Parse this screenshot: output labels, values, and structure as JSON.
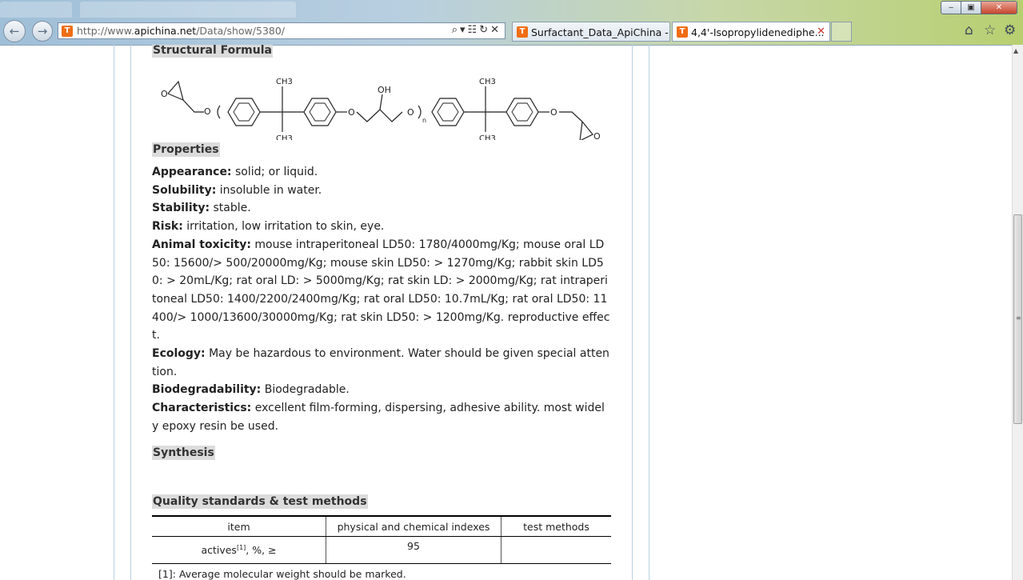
{
  "browser": {
    "url_prefix": "http://www.",
    "url_domain": "apichina.net",
    "url_path": "/Data/show/5380/",
    "tabs": [
      {
        "label": "Surfactant_Data_ApiChina - ..."
      },
      {
        "label": "4,4'-Isopropylidenediphe..."
      }
    ]
  },
  "page": {
    "structural_formula_heading": "Structural Formula",
    "properties_heading": "Properties",
    "properties": [
      {
        "label": "Appearance:",
        "value": " solid; or liquid."
      },
      {
        "label": "Solubility:",
        "value": " insoluble in water."
      },
      {
        "label": "Stability:",
        "value": " stable."
      },
      {
        "label": "Risk:",
        "value": " irritation, low irritation to skin, eye."
      },
      {
        "label": "Animal toxicity:",
        "value": " mouse intraperitoneal LD50: 1780/4000mg/Kg; mouse oral LD50: 15600/> 500/20000mg/Kg; mouse skin LD50: > 1270mg/Kg; rabbit skin LD50: > 20mL/Kg; rat oral LD: > 5000mg/Kg; rat skin LD: > 2000mg/Kg; rat intraperitoneal LD50: 1400/2200/2400mg/Kg; rat oral LD50: 10.7mL/Kg; rat oral LD50: 11400/> 1000/13600/30000mg/Kg; rat skin LD50: > 1200mg/Kg. reproductive effect."
      },
      {
        "label": "Ecology:",
        "value": " May be hazardous to environment. Water should be given special attention."
      },
      {
        "label": "Biodegradability:",
        "value": " Biodegradable."
      },
      {
        "label": "Characteristics:",
        "value": " excellent film-forming, dispersing, adhesive ability. most widely epoxy resin be used."
      }
    ],
    "synthesis_heading": "Synthesis",
    "quality_heading": "Quality standards & test methods",
    "table": {
      "headers": [
        "item",
        "physical and chemical indexes",
        "test methods"
      ],
      "row_item": "actives",
      "row_item_sup": "[1]",
      "row_item_suffix": ", %, ≥",
      "row_value": "95",
      "row_method": "",
      "footnote": "[1]: Average molecular weight should be marked."
    }
  },
  "formula_labels": {
    "o": "O",
    "ch3": "CH3",
    "oh": "OH",
    "n": "n"
  },
  "colors": {
    "accent_orange": "#f06d13",
    "section_bg": "#dcdcdc",
    "column_border": "#b9d1e3"
  }
}
